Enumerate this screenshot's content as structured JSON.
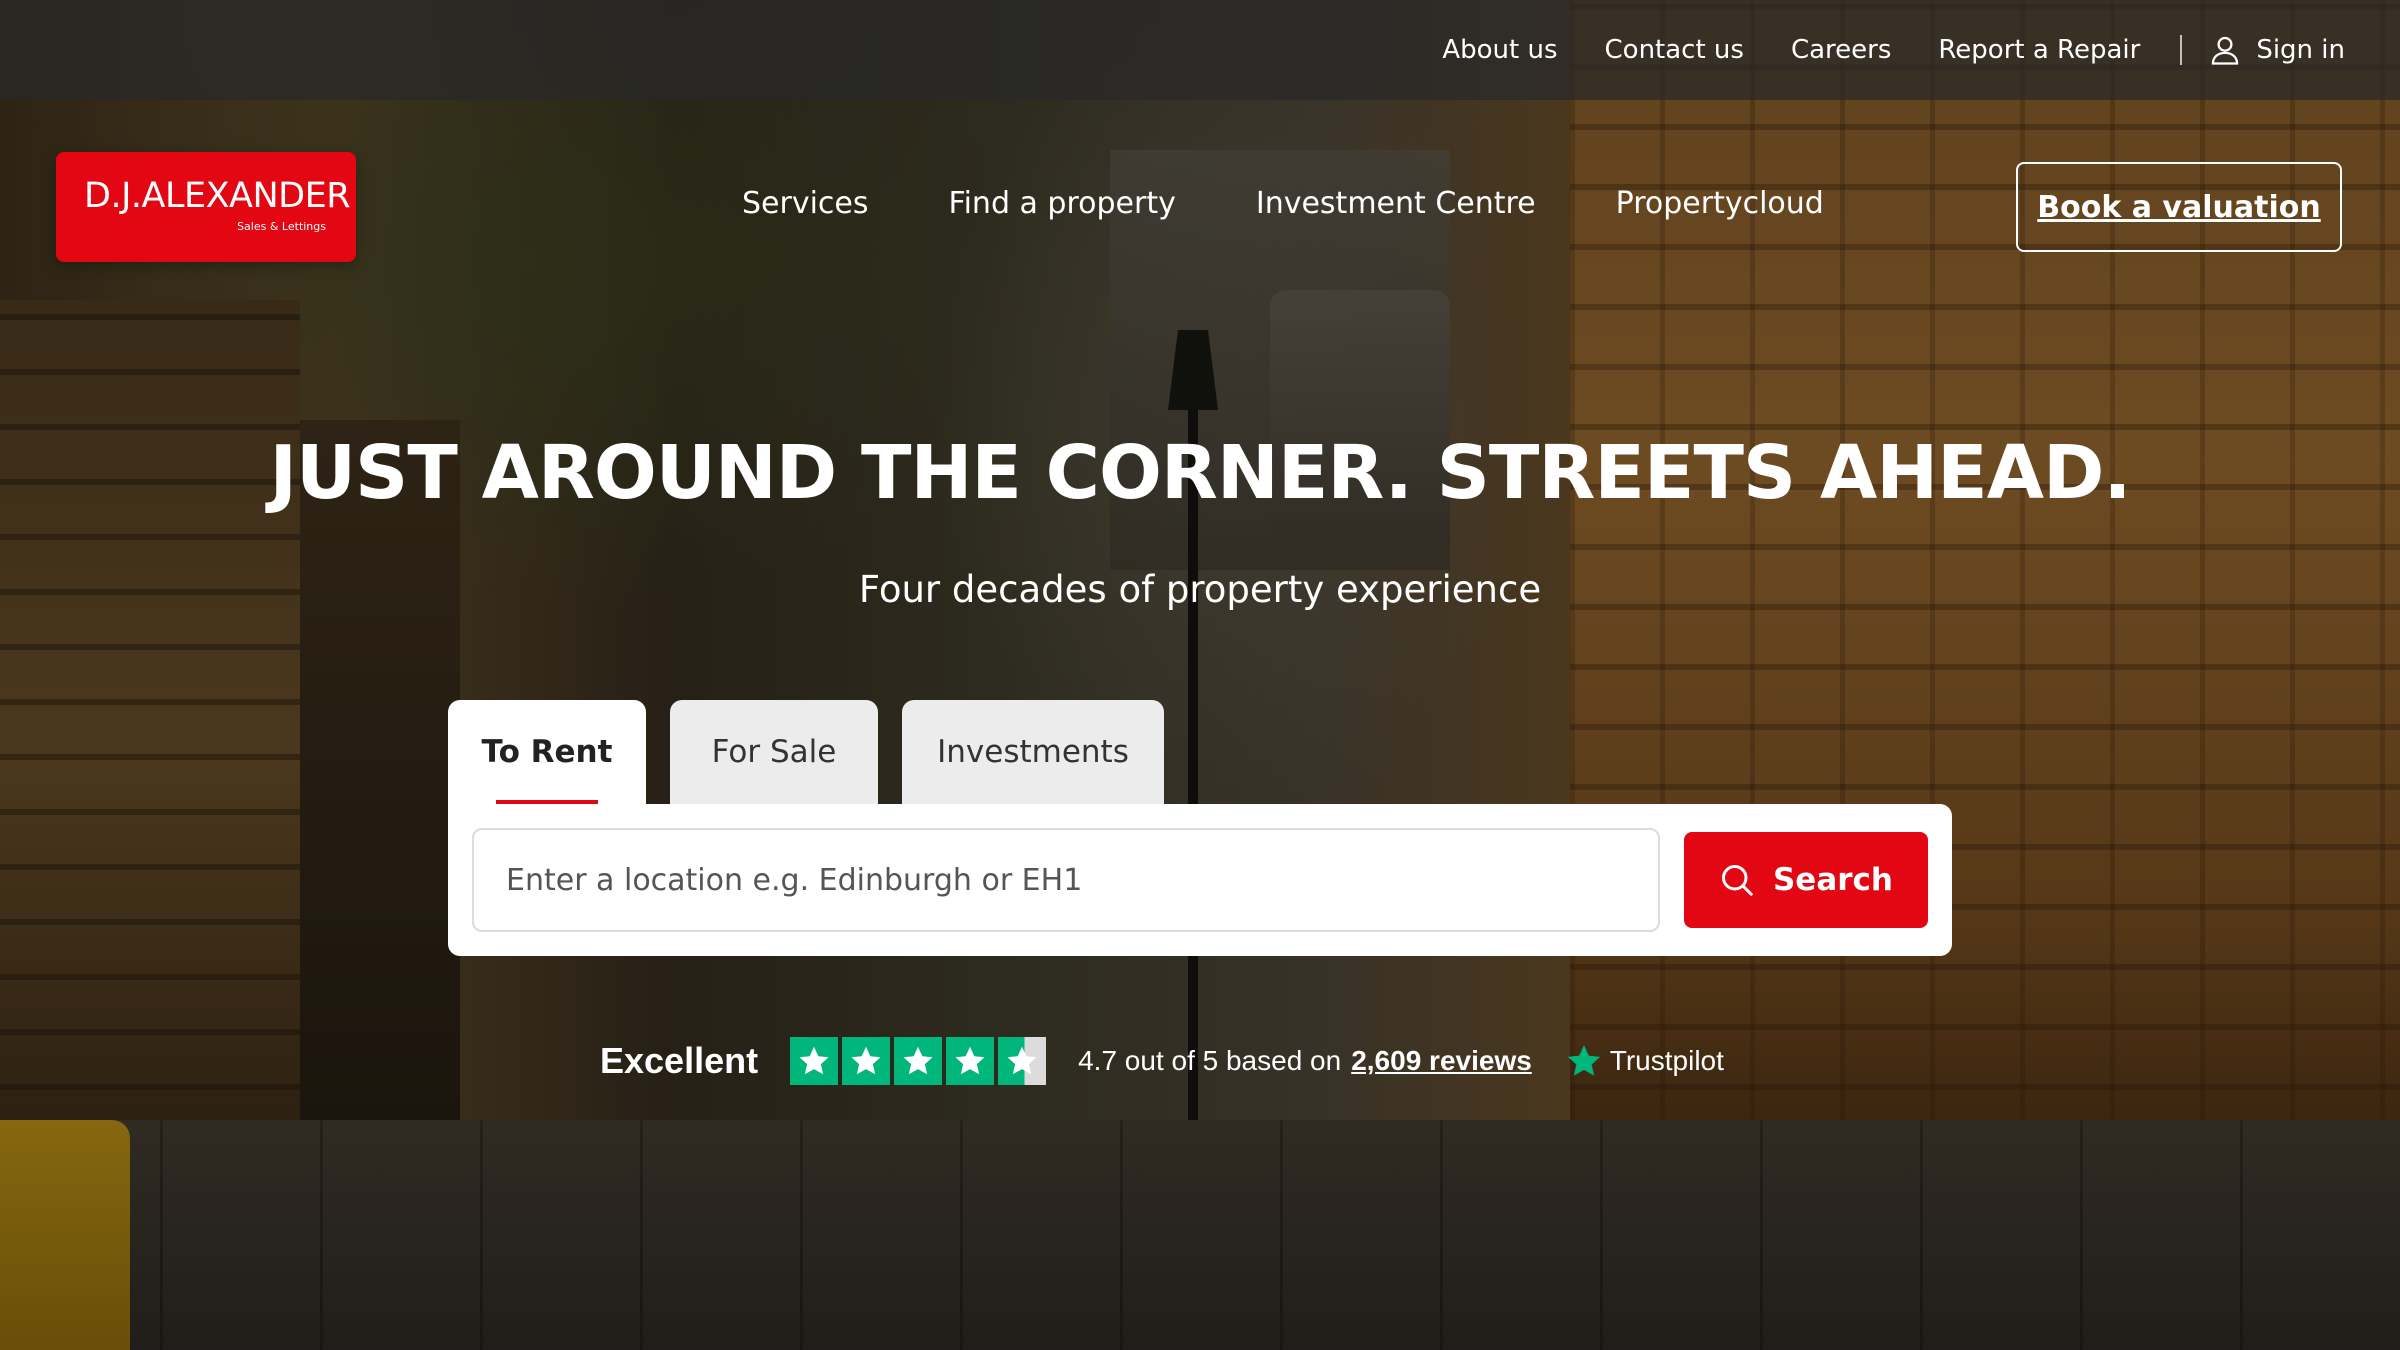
{
  "top_nav": {
    "links": [
      "About us",
      "Contact us",
      "Careers",
      "Report a Repair"
    ],
    "sign_in": "Sign in"
  },
  "logo": {
    "name": "D.J.ALEXANDER",
    "tagline": "Sales & Lettings",
    "brand_color": "#e30613"
  },
  "main_nav": {
    "items": [
      "Services",
      "Find a property",
      "Investment Centre",
      "Propertycloud"
    ],
    "cta": "Book a valuation"
  },
  "hero": {
    "title": "JUST AROUND THE CORNER. STREETS AHEAD.",
    "subtitle": "Four decades of property experience"
  },
  "search": {
    "tabs": [
      {
        "label": "To Rent",
        "active": true
      },
      {
        "label": "For Sale",
        "active": false
      },
      {
        "label": "Investments",
        "active": false
      }
    ],
    "placeholder": "Enter a location e.g. Edinburgh or EH1",
    "button": "Search",
    "accent": "#e30613"
  },
  "trustpilot": {
    "verdict": "Excellent",
    "rating_text": "4.7 out of 5 based on",
    "reviews_link": "2,609 reviews",
    "brand": "Trustpilot",
    "stars": 4.5,
    "star_color": "#00b67a"
  },
  "icons": [
    "user-icon",
    "search-icon",
    "star-icon",
    "trustpilot-star-icon"
  ]
}
